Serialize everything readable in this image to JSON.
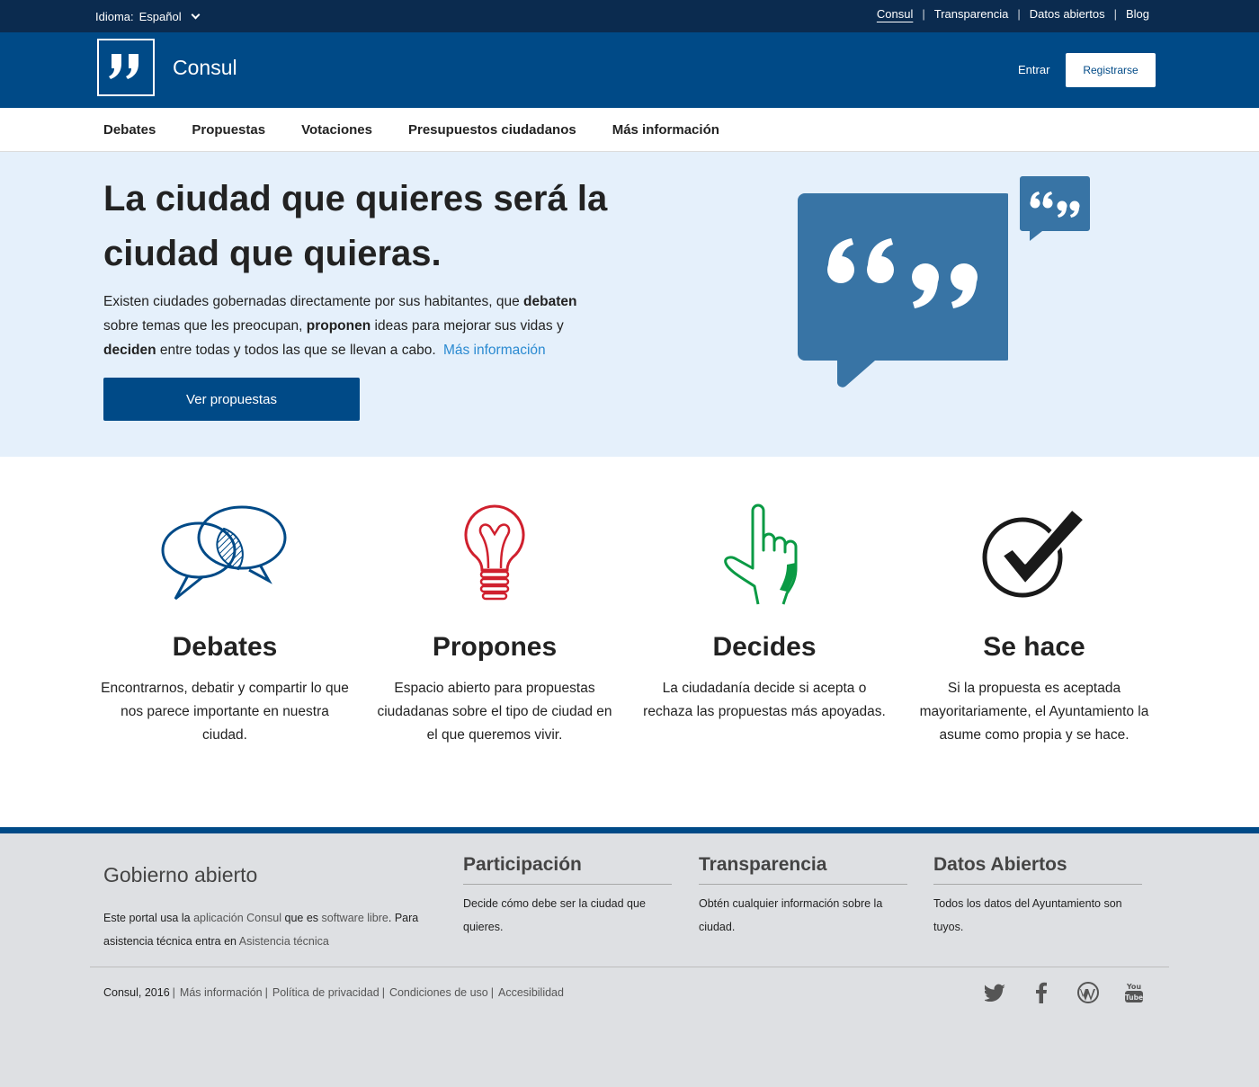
{
  "topbar": {
    "language_label": "Idioma:",
    "language_value": "Español",
    "links": [
      "Consul",
      "Transparencia",
      "Datos abiertos",
      "Blog"
    ],
    "separator": "|"
  },
  "header": {
    "site_name": "Consul",
    "login": "Entrar",
    "register": "Registrarse"
  },
  "nav": {
    "items": [
      "Debates",
      "Propuestas",
      "Votaciones",
      "Presupuestos ciudadanos",
      "Más información"
    ]
  },
  "hero": {
    "title": "La ciudad que quieres será la ciudad que quieras.",
    "text_1": "Existen ciudades gobernadas directamente por sus habitantes, que ",
    "bold_1": "debaten",
    "text_2": " sobre temas que les preocupan, ",
    "bold_2": "proponen",
    "text_3": " ideas para mejorar sus vidas y ",
    "bold_3": "deciden",
    "text_4": " entre todas y todos las que se llevan a cabo.",
    "more_link": "Más información",
    "cta": "Ver propuestas"
  },
  "features": [
    {
      "title": "Debates",
      "text": "Encontrarnos, debatir y compartir lo que nos parece importante en nuestra ciudad.",
      "icon": "speech-bubbles-icon"
    },
    {
      "title": "Propones",
      "text": "Espacio abierto para propuestas ciudadanas sobre el tipo de ciudad en el que queremos vivir.",
      "icon": "lightbulb-icon"
    },
    {
      "title": "Decides",
      "text": "La ciudadanía decide si acepta o rechaza las propuestas más apoyadas.",
      "icon": "pointing-hand-icon"
    },
    {
      "title": "Se hace",
      "text": "Si la propuesta es aceptada mayoritariamente, el Ayuntamiento la asume como propia y se hace.",
      "icon": "checkmark-icon"
    }
  ],
  "footer": {
    "gob_title": "Gobierno abierto",
    "gob_text_1": "Este portal usa la ",
    "gob_link_1": "aplicación Consul",
    "gob_text_2": " que es ",
    "gob_link_2": "software libre",
    "gob_text_3": ". Para asistencia técnica entra en ",
    "gob_link_3": "Asistencia técnica",
    "columns": [
      {
        "title": "Participación",
        "text": "Decide cómo debe ser la ciudad que quieres."
      },
      {
        "title": "Transparencia",
        "text": "Obtén cualquier información sobre la ciudad."
      },
      {
        "title": "Datos Abiertos",
        "text": "Todos los datos del Ayuntamiento son tuyos."
      }
    ],
    "copyright": "Consul, 2016",
    "legal_links": [
      "Más información",
      "Política de privacidad",
      "Condiciones de uso",
      "Accesibilidad"
    ],
    "social": [
      "twitter-icon",
      "facebook-icon",
      "wordpress-icon",
      "youtube-icon"
    ]
  },
  "colors": {
    "topbar": "#0b2b4f",
    "brand": "#004a87",
    "hero_bg": "#e5f0fb",
    "bubble": "#3874a5",
    "debates": "#004a87",
    "propones": "#d0202e",
    "decides": "#0a9a44",
    "se_hace": "#1a1a1a",
    "footer_bg": "#dee0e3"
  }
}
